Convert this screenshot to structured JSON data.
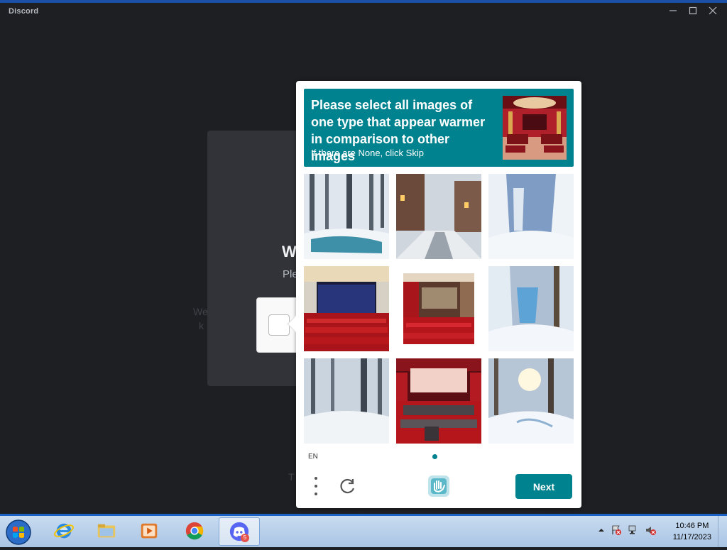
{
  "window": {
    "app_name": "Discord"
  },
  "login": {
    "heading": "W",
    "subtitle": "Ple",
    "faded_line1": "We",
    "faded_line2": "k",
    "below_text": "T"
  },
  "challenge": {
    "prompt": "Please select all images of one type that appear warmer in comparison to other images",
    "prompt_hint": "If there are None, click Skip",
    "language": "EN",
    "next_label": "Next",
    "images": [
      "snowy forest with stream",
      "snowy city street",
      "snowy forest path",
      "red cinema hall",
      "red theater hall",
      "snowy forest path",
      "snowy forest",
      "red cinema with screen",
      "snowy forest with sun"
    ],
    "accent_color": "#00838f"
  },
  "taskbar": {
    "apps": [
      "start-orb",
      "internet-explorer",
      "file-explorer",
      "media-player",
      "chrome",
      "discord"
    ],
    "discord_badge": "5",
    "time": "10:46 PM",
    "date": "11/17/2023"
  }
}
